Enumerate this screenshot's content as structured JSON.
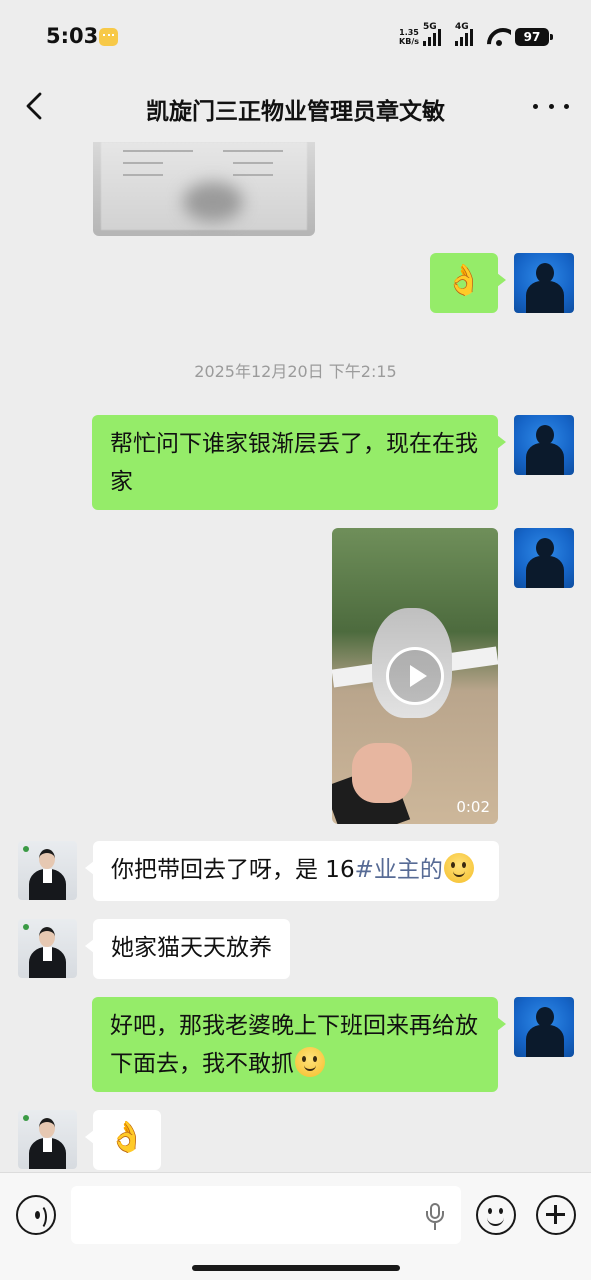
{
  "status_bar": {
    "time": "5:03",
    "net_speed_value": "1.35",
    "net_speed_unit": "KB/s",
    "signal_1_label": "5G",
    "signal_2_label": "4G",
    "battery": "97"
  },
  "header": {
    "title": "凯旋门三正物业管理员章文敏"
  },
  "messages": {
    "m1_emoji": "👌",
    "timestamp": "2025年12月20日 下午2:15",
    "m2_text": "帮忙问下谁家银渐层丢了，现在在我家",
    "video_duration": "0:02",
    "m3_text_before": "你把带回去了呀，是 16",
    "m3_hashtag": "#业主的",
    "m4_text": "她家猫天天放养",
    "m5_text": "好吧，那我老婆晚上下班回来再给放下面去，我不敢抓",
    "m6_emoji": "👌"
  },
  "input": {
    "placeholder": "",
    "value": ""
  },
  "colors": {
    "my_bubble": "#95ec69",
    "their_bubble": "#ffffff",
    "background": "#ededed",
    "hashtag": "#576b95"
  }
}
